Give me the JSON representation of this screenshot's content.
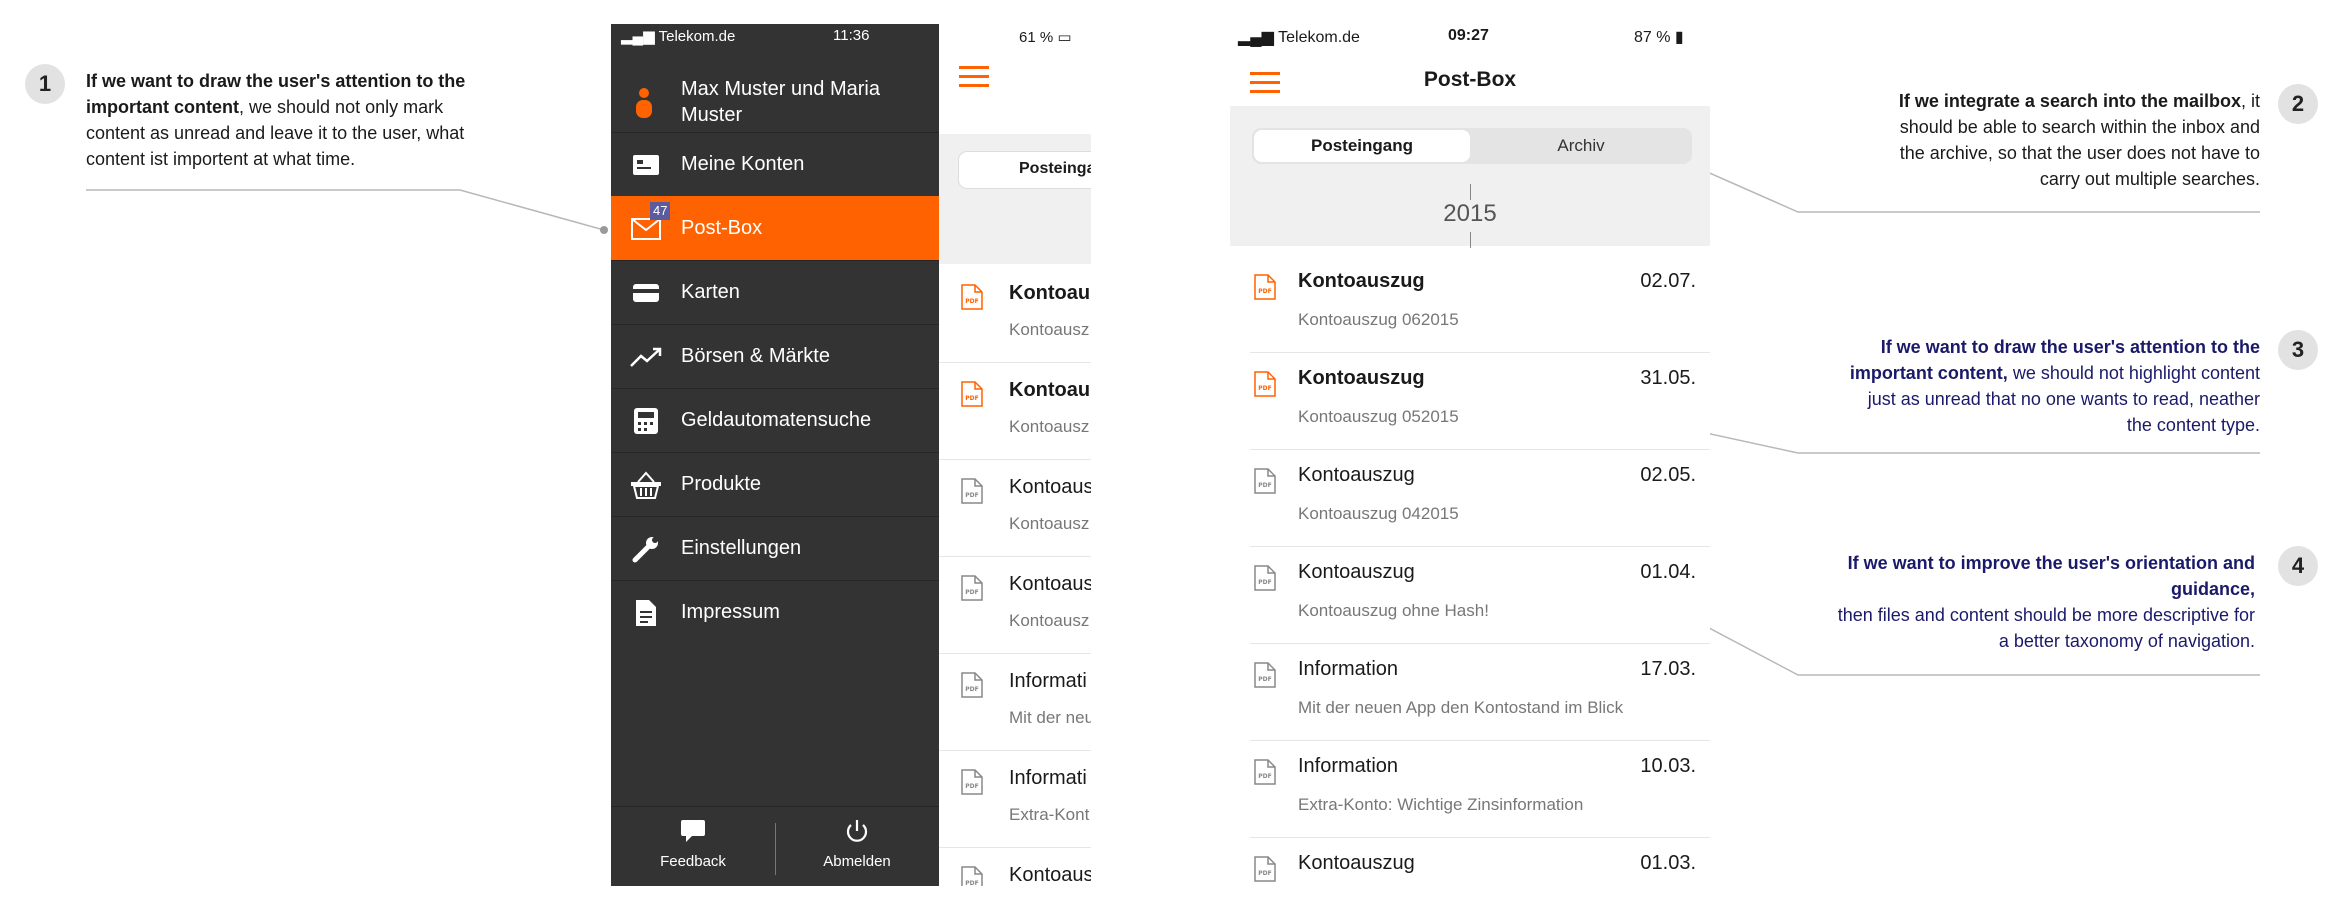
{
  "annotations": [
    {
      "num": "1",
      "bold": "If we want to draw the user's attention to the important content",
      "rest": ", we should not only mark content as unread and leave it to the user, what content ist importent at what time."
    },
    {
      "num": "2",
      "bold": "If we integrate a search into the mailbox",
      "rest": ", it should be able to search within the inbox and the archive, so that the user does not have to carry out multiple searches."
    },
    {
      "num": "3",
      "bold": "If we want to draw the user's attention to the important content,",
      "rest": " we should not highlight content just as unread that no one wants to read, neather the content type."
    },
    {
      "num": "4",
      "bold": "If we want to improve the user's orientation and guidance,",
      "rest": "then files and content should be more descriptive for a better taxonomy of navigation."
    }
  ],
  "drawer": {
    "status": {
      "carrier": "Telekom.de",
      "time": "11:36"
    },
    "user_name": "Max Muster und Maria Muster",
    "items": [
      {
        "label": "Meine Konten",
        "icon": "account-card-icon"
      },
      {
        "label": "Post-Box",
        "icon": "mail-icon",
        "badge": "47",
        "active": true
      },
      {
        "label": "Karten",
        "icon": "credit-card-icon"
      },
      {
        "label": "Börsen & Märkte",
        "icon": "trend-icon"
      },
      {
        "label": "Geldautomatensuche",
        "icon": "atm-icon"
      },
      {
        "label": "Produkte",
        "icon": "basket-icon"
      },
      {
        "label": "Einstellungen",
        "icon": "wrench-icon"
      },
      {
        "label": "Impressum",
        "icon": "document-icon"
      }
    ],
    "feedback": "Feedback",
    "logout": "Abmelden"
  },
  "partial": {
    "battery": "61 %",
    "seg": "Posteinga",
    "rows": [
      {
        "title": "Kontoaus",
        "sub": "Kontoausz",
        "bold": true,
        "orange": true
      },
      {
        "title": "Kontoaus",
        "sub": "Kontoausz",
        "bold": true,
        "orange": true
      },
      {
        "title": "Kontoaus",
        "sub": "Kontoausz",
        "bold": false,
        "orange": false
      },
      {
        "title": "Kontoaus",
        "sub": "Kontoausz",
        "bold": false,
        "orange": false
      },
      {
        "title": "Informati",
        "sub": "Mit der neu",
        "bold": false,
        "orange": false
      },
      {
        "title": "Informati",
        "sub": "Extra-Kont",
        "bold": false,
        "orange": false
      },
      {
        "title": "Kontoaus",
        "sub": "",
        "bold": false,
        "orange": false
      }
    ]
  },
  "postbox": {
    "status": {
      "carrier": "Telekom.de",
      "time": "09:27",
      "battery": "87 %"
    },
    "title": "Post-Box",
    "tab_inbox": "Posteingang",
    "tab_archive": "Archiv",
    "year": "2015",
    "rows": [
      {
        "title": "Kontoauszug",
        "date": "02.07.",
        "sub": "Kontoauszug 062015",
        "bold": true,
        "orange": true
      },
      {
        "title": "Kontoauszug",
        "date": "31.05.",
        "sub": "Kontoauszug 052015",
        "bold": true,
        "orange": true
      },
      {
        "title": "Kontoauszug",
        "date": "02.05.",
        "sub": "Kontoauszug 042015",
        "bold": false,
        "orange": false
      },
      {
        "title": "Kontoauszug",
        "date": "01.04.",
        "sub": "Kontoauszug ohne Hash!",
        "bold": false,
        "orange": false
      },
      {
        "title": "Information",
        "date": "17.03.",
        "sub": "Mit der neuen App den Kontostand im Blick",
        "bold": false,
        "orange": false
      },
      {
        "title": "Information",
        "date": "10.03.",
        "sub": "Extra-Konto: Wichtige Zinsinformation",
        "bold": false,
        "orange": false
      },
      {
        "title": "Kontoauszug",
        "date": "01.03.",
        "sub": "",
        "bold": false,
        "orange": false
      }
    ]
  },
  "colors": {
    "accent": "#ff6200",
    "drawer": "#333333",
    "note_dark": "#1b1a6a"
  }
}
